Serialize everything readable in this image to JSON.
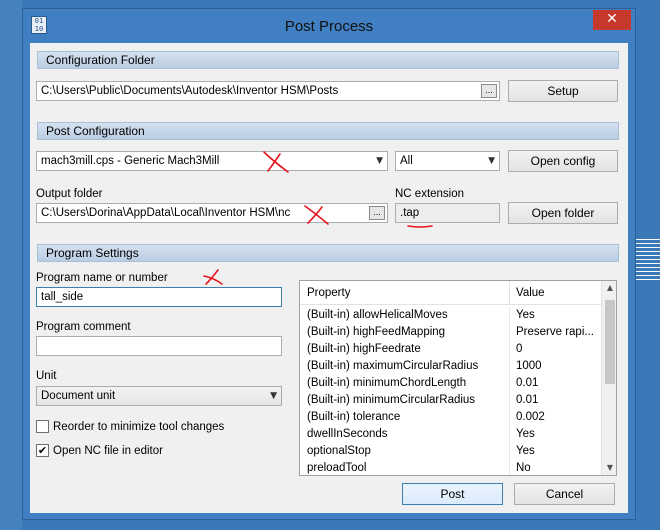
{
  "window": {
    "title": "Post Process",
    "close_glyph": "✕",
    "icon_text": "01\n10"
  },
  "config_folder": {
    "header": "Configuration Folder",
    "path": "C:\\Users\\Public\\Documents\\Autodesk\\Inventor HSM\\Posts",
    "browse_label": "...",
    "setup_label": "Setup"
  },
  "post_config": {
    "header": "Post Configuration",
    "post_selected": "mach3mill.cps - Generic Mach3Mill",
    "filter_selected": "All",
    "open_config_label": "Open config",
    "output_folder_label": "Output folder",
    "output_folder_path": "C:\\Users\\Dorina\\AppData\\Local\\Inventor HSM\\nc",
    "output_browse_label": "...",
    "nc_extension_label": "NC extension",
    "nc_extension_value": ".tap",
    "open_folder_label": "Open folder"
  },
  "program_settings": {
    "header": "Program Settings",
    "program_name_label": "Program name or number",
    "program_name_value": "tall_side",
    "program_comment_label": "Program comment",
    "program_comment_value": "",
    "unit_label": "Unit",
    "unit_selected": "Document unit",
    "reorder_label": "Reorder to minimize tool changes",
    "reorder_checked": false,
    "open_nc_label": "Open NC file in editor",
    "open_nc_checked": true,
    "check_glyph": "✔"
  },
  "properties": {
    "col_property": "Property",
    "col_value": "Value",
    "rows": [
      {
        "name": "(Built-in) allowHelicalMoves",
        "value": "Yes"
      },
      {
        "name": "(Built-in) highFeedMapping",
        "value": "Preserve rapi..."
      },
      {
        "name": "(Built-in) highFeedrate",
        "value": "0"
      },
      {
        "name": "(Built-in) maximumCircularRadius",
        "value": "1000"
      },
      {
        "name": "(Built-in) minimumChordLength",
        "value": "0.01"
      },
      {
        "name": "(Built-in) minimumCircularRadius",
        "value": "0.01"
      },
      {
        "name": "(Built-in) tolerance",
        "value": "0.002"
      },
      {
        "name": "dwellInSeconds",
        "value": "Yes"
      },
      {
        "name": "optionalStop",
        "value": "Yes"
      },
      {
        "name": "preloadTool",
        "value": "No"
      }
    ]
  },
  "actions": {
    "post_label": "Post",
    "cancel_label": "Cancel"
  },
  "icons": {
    "dropdown": "▼",
    "scroll_up": "▲",
    "scroll_down": "▼"
  },
  "annotation_color": "#e8141c"
}
